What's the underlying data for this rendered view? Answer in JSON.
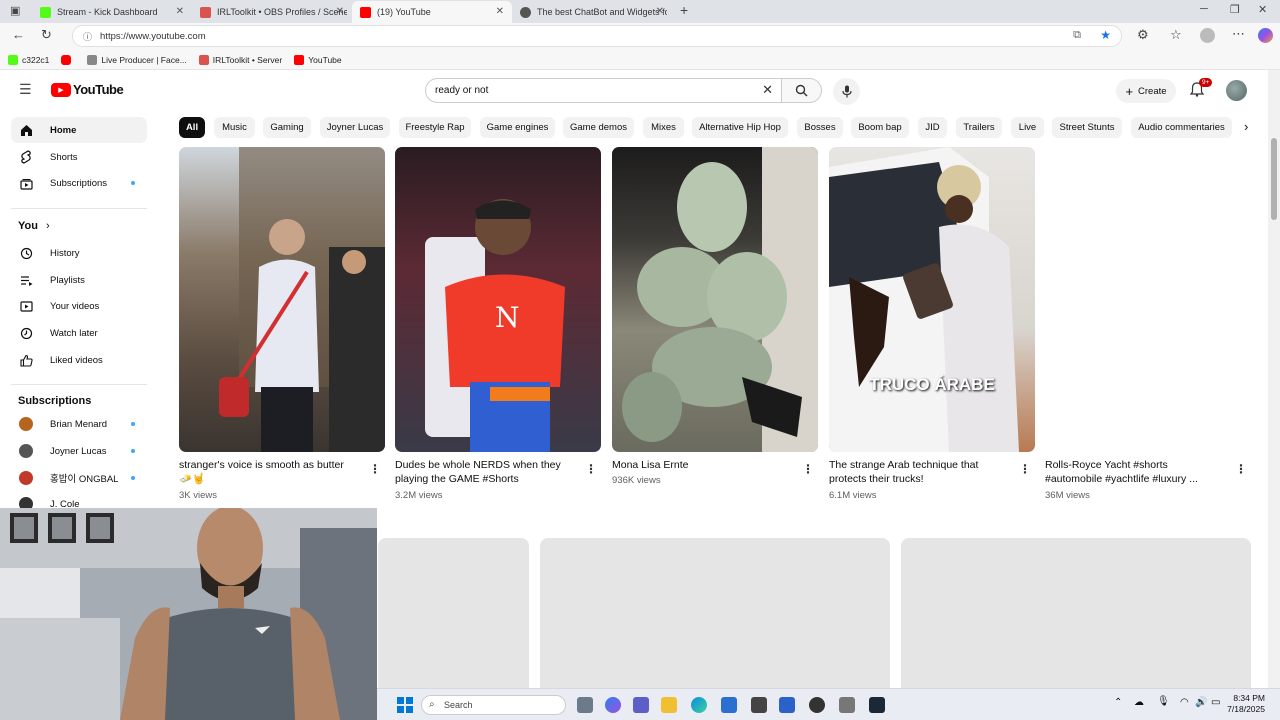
{
  "browser": {
    "tabs": [
      {
        "title": "Stream - Kick Dashboard",
        "color": "#53fc18"
      },
      {
        "title": "IRLToolkit • OBS Profiles / Scenes",
        "color": "#d9534f"
      },
      {
        "title": "(19) YouTube",
        "color": "#ff0000"
      },
      {
        "title": "The best ChatBot and Widgets fo",
        "color": "#555555"
      }
    ],
    "new_tab": "+",
    "url": "https://www.youtube.com",
    "bookmarks": [
      {
        "label": "c322c1",
        "color": "#53fc18"
      },
      {
        "label": "Live Producer | Face...",
        "color": "#888888"
      },
      {
        "label": "IRLToolkit • Server",
        "color": "#d9534f"
      },
      {
        "label": "YouTube",
        "color": "#ff0000"
      }
    ]
  },
  "youtube": {
    "logo_text": "YouTube",
    "search_value": "ready or not",
    "create_label": "Create",
    "notif_badge": "9+",
    "sidebar": {
      "main": [
        {
          "label": "Home",
          "icon": "home-icon",
          "active": true
        },
        {
          "label": "Shorts",
          "icon": "shorts-icon"
        },
        {
          "label": "Subscriptions",
          "icon": "subscriptions-icon",
          "dot": true
        }
      ],
      "you_header": "You",
      "you": [
        {
          "label": "History",
          "icon": "history-icon"
        },
        {
          "label": "Playlists",
          "icon": "playlists-icon"
        },
        {
          "label": "Your videos",
          "icon": "your-videos-icon"
        },
        {
          "label": "Watch later",
          "icon": "watch-later-icon"
        },
        {
          "label": "Liked videos",
          "icon": "liked-icon"
        }
      ],
      "subs_header": "Subscriptions",
      "subs": [
        {
          "label": "Brian Menard",
          "color": "#b5651d"
        },
        {
          "label": "Joyner Lucas",
          "color": "#555555"
        },
        {
          "label": "홍밥이 ONGBAL",
          "color": "#c0392b"
        },
        {
          "label": "J. Cole",
          "color": "#333333"
        }
      ]
    },
    "chips": [
      "All",
      "Music",
      "Gaming",
      "Joyner Lucas",
      "Freestyle Rap",
      "Game engines",
      "Game demos",
      "Mixes",
      "Alternative Hip Hop",
      "Bosses",
      "Boom bap",
      "JID",
      "Trailers",
      "Live",
      "Street Stunts",
      "Audio commentaries"
    ],
    "shorts": [
      {
        "title": "stranger's voice is smooth as butter 🧈🤘",
        "views": "3K views"
      },
      {
        "title": "Dudes be whole NERDS when they playing the GAME #Shorts",
        "views": "3.2M views"
      },
      {
        "title": "Mona Lisa Ernte",
        "views": "936K views"
      },
      {
        "title": "The strange Arab technique that protects their trucks!",
        "views": "6.1M views",
        "overlay": "TRUCO ÁRABE"
      },
      {
        "title": "Rolls-Royce Yacht  #shorts #automobile #yachtlife #luxury ...",
        "views": "36M views"
      }
    ]
  },
  "taskbar": {
    "search_placeholder": "Search",
    "time": "8:34 PM",
    "date": "7/18/2025"
  }
}
